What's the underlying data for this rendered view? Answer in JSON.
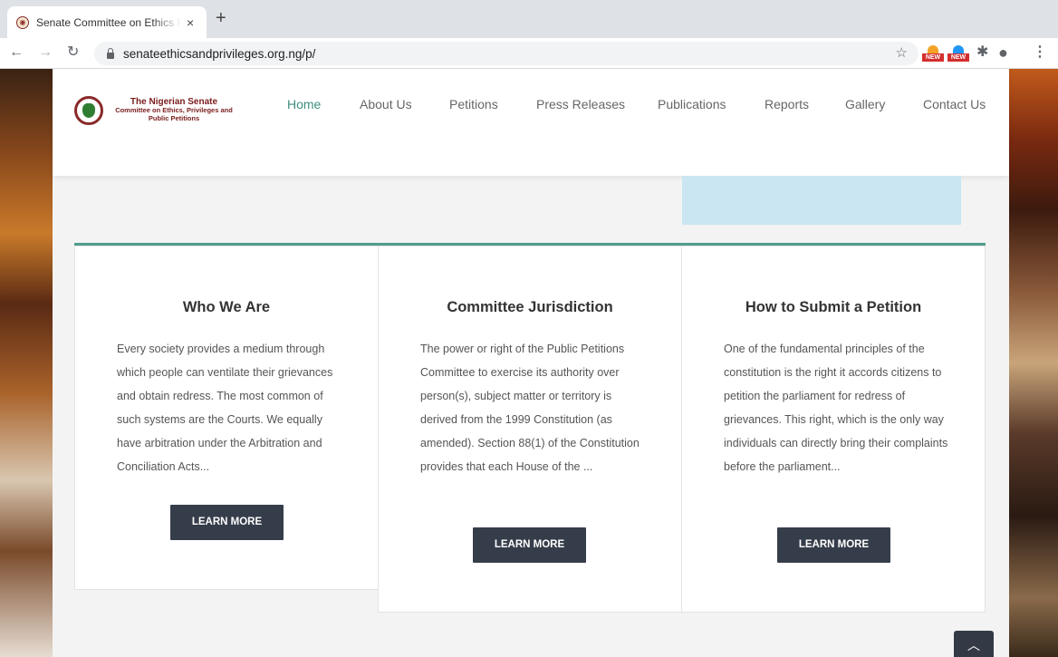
{
  "browser": {
    "tab_title": "Senate Committee on Ethics Pr",
    "tab_close": "×",
    "new_tab": "+",
    "url": "senateethicsandprivileges.org.ng/p/",
    "ext_badge": "NEW"
  },
  "site": {
    "logo_line1": "The Nigerian Senate",
    "logo_line2": "Committee on Ethics, Privileges and",
    "logo_line3": "Public Petitions"
  },
  "nav": {
    "items": [
      "Home",
      "About Us",
      "Petitions",
      "Press Releases",
      "Publications",
      "Reports",
      "Gallery",
      "Contact Us"
    ],
    "active": "Home"
  },
  "cards": [
    {
      "title": "Who We Are",
      "body": "Every society provides a medium through which people can ventilate their grievances and obtain redress. The most common of such systems are the Courts. We equally have arbitration under the Arbitration and Conciliation Acts...",
      "button": "LEARN MORE"
    },
    {
      "title": "Committee Jurisdiction",
      "body": "The power or right of the Public Petitions Committee to exercise its authority over person(s), subject matter or territory is derived from the 1999 Constitution (as amended). Section 88(1) of the Constitution provides that each House of the ...",
      "button": "LEARN MORE"
    },
    {
      "title": "How to Submit a Petition",
      "body": "One of the fundamental principles of the constitution is the right it accords citizens to petition the parliament for redress of grievances. This right, which is the only way individuals can directly bring their complaints before the parliament...",
      "button": "LEARN MORE"
    }
  ],
  "colors": {
    "accent": "#3c8d7e",
    "button": "#363d4a",
    "logo": "#7a1c1c"
  }
}
